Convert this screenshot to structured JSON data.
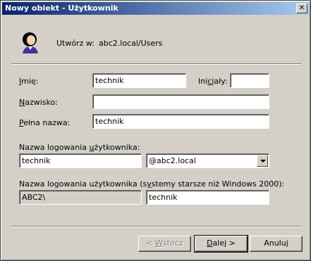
{
  "window": {
    "title": "Nowy obiekt - Użytkownik",
    "close_glyph": "✕"
  },
  "header": {
    "icon": "user-icon",
    "create_in_label": "Utwórz w:",
    "create_in_value": "abc2.local/Users"
  },
  "form": {
    "first_name": {
      "label": "Imię:",
      "value": "technik"
    },
    "initials": {
      "label": "Inicjały:",
      "value": ""
    },
    "last_name": {
      "label": "Nazwisko:",
      "value": ""
    },
    "full_name": {
      "label": "Pełna nazwa:",
      "value": "technik"
    },
    "logon_name": {
      "label": "Nazwa logowania użytkownika:",
      "value": "technik",
      "domain": "@abc2.local"
    },
    "pre2000_logon": {
      "label": "Nazwa logowania użytkownika (systemy starsze niż Windows 2000):",
      "domain": "ABC2\\",
      "value": "technik"
    }
  },
  "buttons": {
    "back": "< Wstecz",
    "next": "Dalej >",
    "cancel": "Anuluj"
  }
}
